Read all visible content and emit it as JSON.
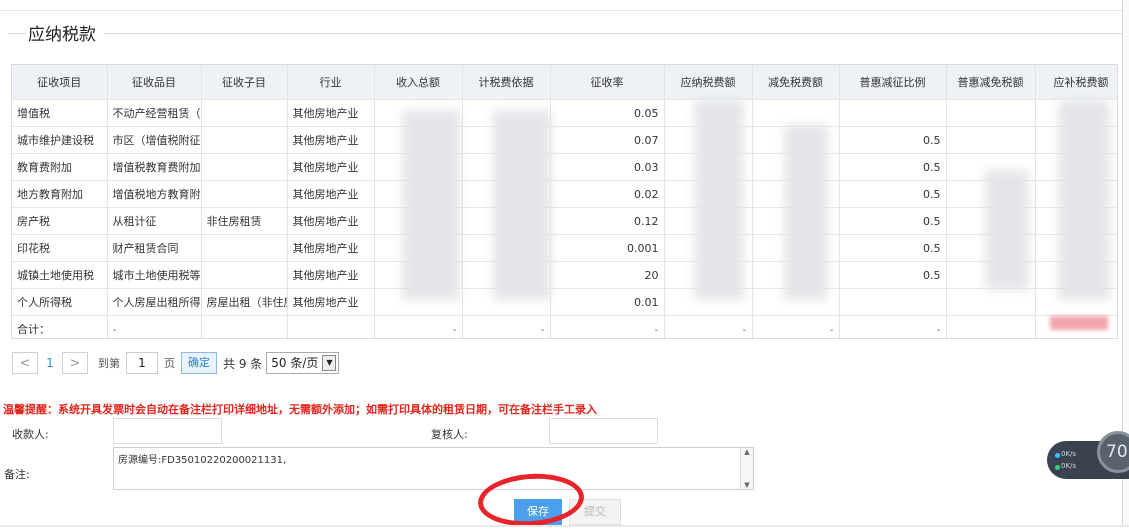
{
  "section": {
    "title": "应纳税款"
  },
  "table": {
    "headers": [
      "征收项目",
      "征收品目",
      "征收子目",
      "行业",
      "收入总额",
      "计税费依据",
      "征收率",
      "应纳税费额",
      "减免税费额",
      "普惠减征比例",
      "普惠减免税额",
      "应补税费额"
    ],
    "rows": [
      [
        "增值税",
        "不动产经营租赁（",
        "",
        "其他房地产业",
        "",
        "",
        "0.05",
        "",
        "",
        "",
        "",
        ""
      ],
      [
        "城市维护建设税",
        "市区（增值税附征",
        "",
        "其他房地产业",
        "",
        "",
        "0.07",
        "",
        "",
        "0.5",
        "",
        ""
      ],
      [
        "教育费附加",
        "增值税教育费附加",
        "",
        "其他房地产业",
        "",
        "",
        "0.03",
        "",
        "",
        "0.5",
        "",
        ""
      ],
      [
        "地方教育附加",
        "增值税地方教育附",
        "",
        "其他房地产业",
        "",
        "",
        "0.02",
        "",
        "",
        "0.5",
        "",
        ""
      ],
      [
        "房产税",
        "从租计征",
        "非住房租赁",
        "其他房地产业",
        "",
        "",
        "0.12",
        "",
        "",
        "0.5",
        "",
        ""
      ],
      [
        "印花税",
        "财产租赁合同",
        "",
        "其他房地产业",
        "",
        "",
        "0.001",
        "",
        "",
        "0.5",
        "",
        ""
      ],
      [
        "城镇土地使用税",
        "城市土地使用税等",
        "",
        "其他房地产业",
        "",
        "",
        "20",
        "",
        "",
        "0.5",
        "",
        ""
      ],
      [
        "个人所得税",
        "个人房屋出租所得",
        "房屋出租（非住房",
        "其他房地产业",
        "",
        "",
        "0.01",
        "",
        "",
        "",
        "",
        ""
      ]
    ],
    "total": [
      "合计：",
      "-",
      "",
      "",
      "-",
      "-",
      "-",
      "-",
      "-",
      "-",
      "",
      ""
    ]
  },
  "pager": {
    "prev": "<",
    "page": "1",
    "next": ">",
    "goto_label": "到第",
    "goto_value": "1",
    "page_unit": "页",
    "confirm": "确定",
    "total": "共 9 条",
    "page_size": "50 条/页"
  },
  "notice": "温馨提醒：系统开具发票时会自动在备注栏打印详细地址，无需额外添加；如需打印具体的租赁日期，可在备注栏手工录入",
  "form": {
    "payee_label": "收款人:",
    "payee_value": "",
    "reviewer_label": "复核人:",
    "reviewer_value": "",
    "remark_label": "备注:",
    "remark_value": "房源编号:FD35010220200021131,"
  },
  "buttons": {
    "save": "保存",
    "submit": "提交"
  },
  "widget": {
    "up_speed": "0K/s",
    "down_speed": "0K/s",
    "percent": "70"
  },
  "colors": {
    "accent": "#4aa0ea",
    "warning": "#e0271d",
    "annotation_circle": "#e8232b"
  }
}
